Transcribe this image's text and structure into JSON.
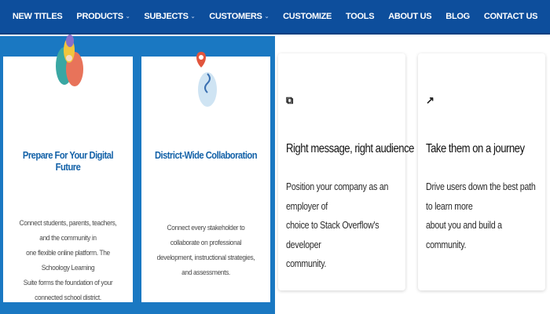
{
  "nav": {
    "items": [
      {
        "label": "NEW TITLES",
        "has_dropdown": false
      },
      {
        "label": "PRODUCTS",
        "has_dropdown": true
      },
      {
        "label": "SUBJECTS",
        "has_dropdown": true
      },
      {
        "label": "CUSTOMERS",
        "has_dropdown": true
      },
      {
        "label": "CUSTOMIZE",
        "has_dropdown": false
      },
      {
        "label": "TOOLS",
        "has_dropdown": false
      },
      {
        "label": "ABOUT US",
        "has_dropdown": false
      },
      {
        "label": "BLOG",
        "has_dropdown": false
      },
      {
        "label": "CONTACT US",
        "has_dropdown": false
      }
    ],
    "caret": "⌄"
  },
  "colors": {
    "nav_bg": "#0d4e9c",
    "left_panel_bg": "#1a78c2",
    "blue_title": "#1462a8"
  },
  "left_cards": [
    {
      "icon": "people-icon",
      "title": "Prepare For Your Digital Future",
      "body_lines": [
        "Connect students, parents, teachers, and the community in",
        "one flexible online platform. The Schoology Learning",
        "Suite forms the foundation of your connected school district."
      ]
    },
    {
      "icon": "map-pin-icon",
      "title": "District-Wide Collaboration",
      "body_lines": [
        "Connect every stakeholder to collaborate on professional",
        "development, instructional strategies, and assessments."
      ]
    }
  ],
  "right_cards": [
    {
      "icon": "stackoverflow-icon",
      "icon_glyph": "⧉",
      "title": "Right message, right audience",
      "body_lines": [
        "Position your company as an employer of",
        "choice to Stack Overflow's developer",
        "community."
      ]
    },
    {
      "icon": "growth-arrow-icon",
      "icon_glyph": "↗",
      "title": "Take them on a journey",
      "body_lines": [
        "Drive users down the best path to learn more",
        "about you and build a community."
      ]
    }
  ]
}
